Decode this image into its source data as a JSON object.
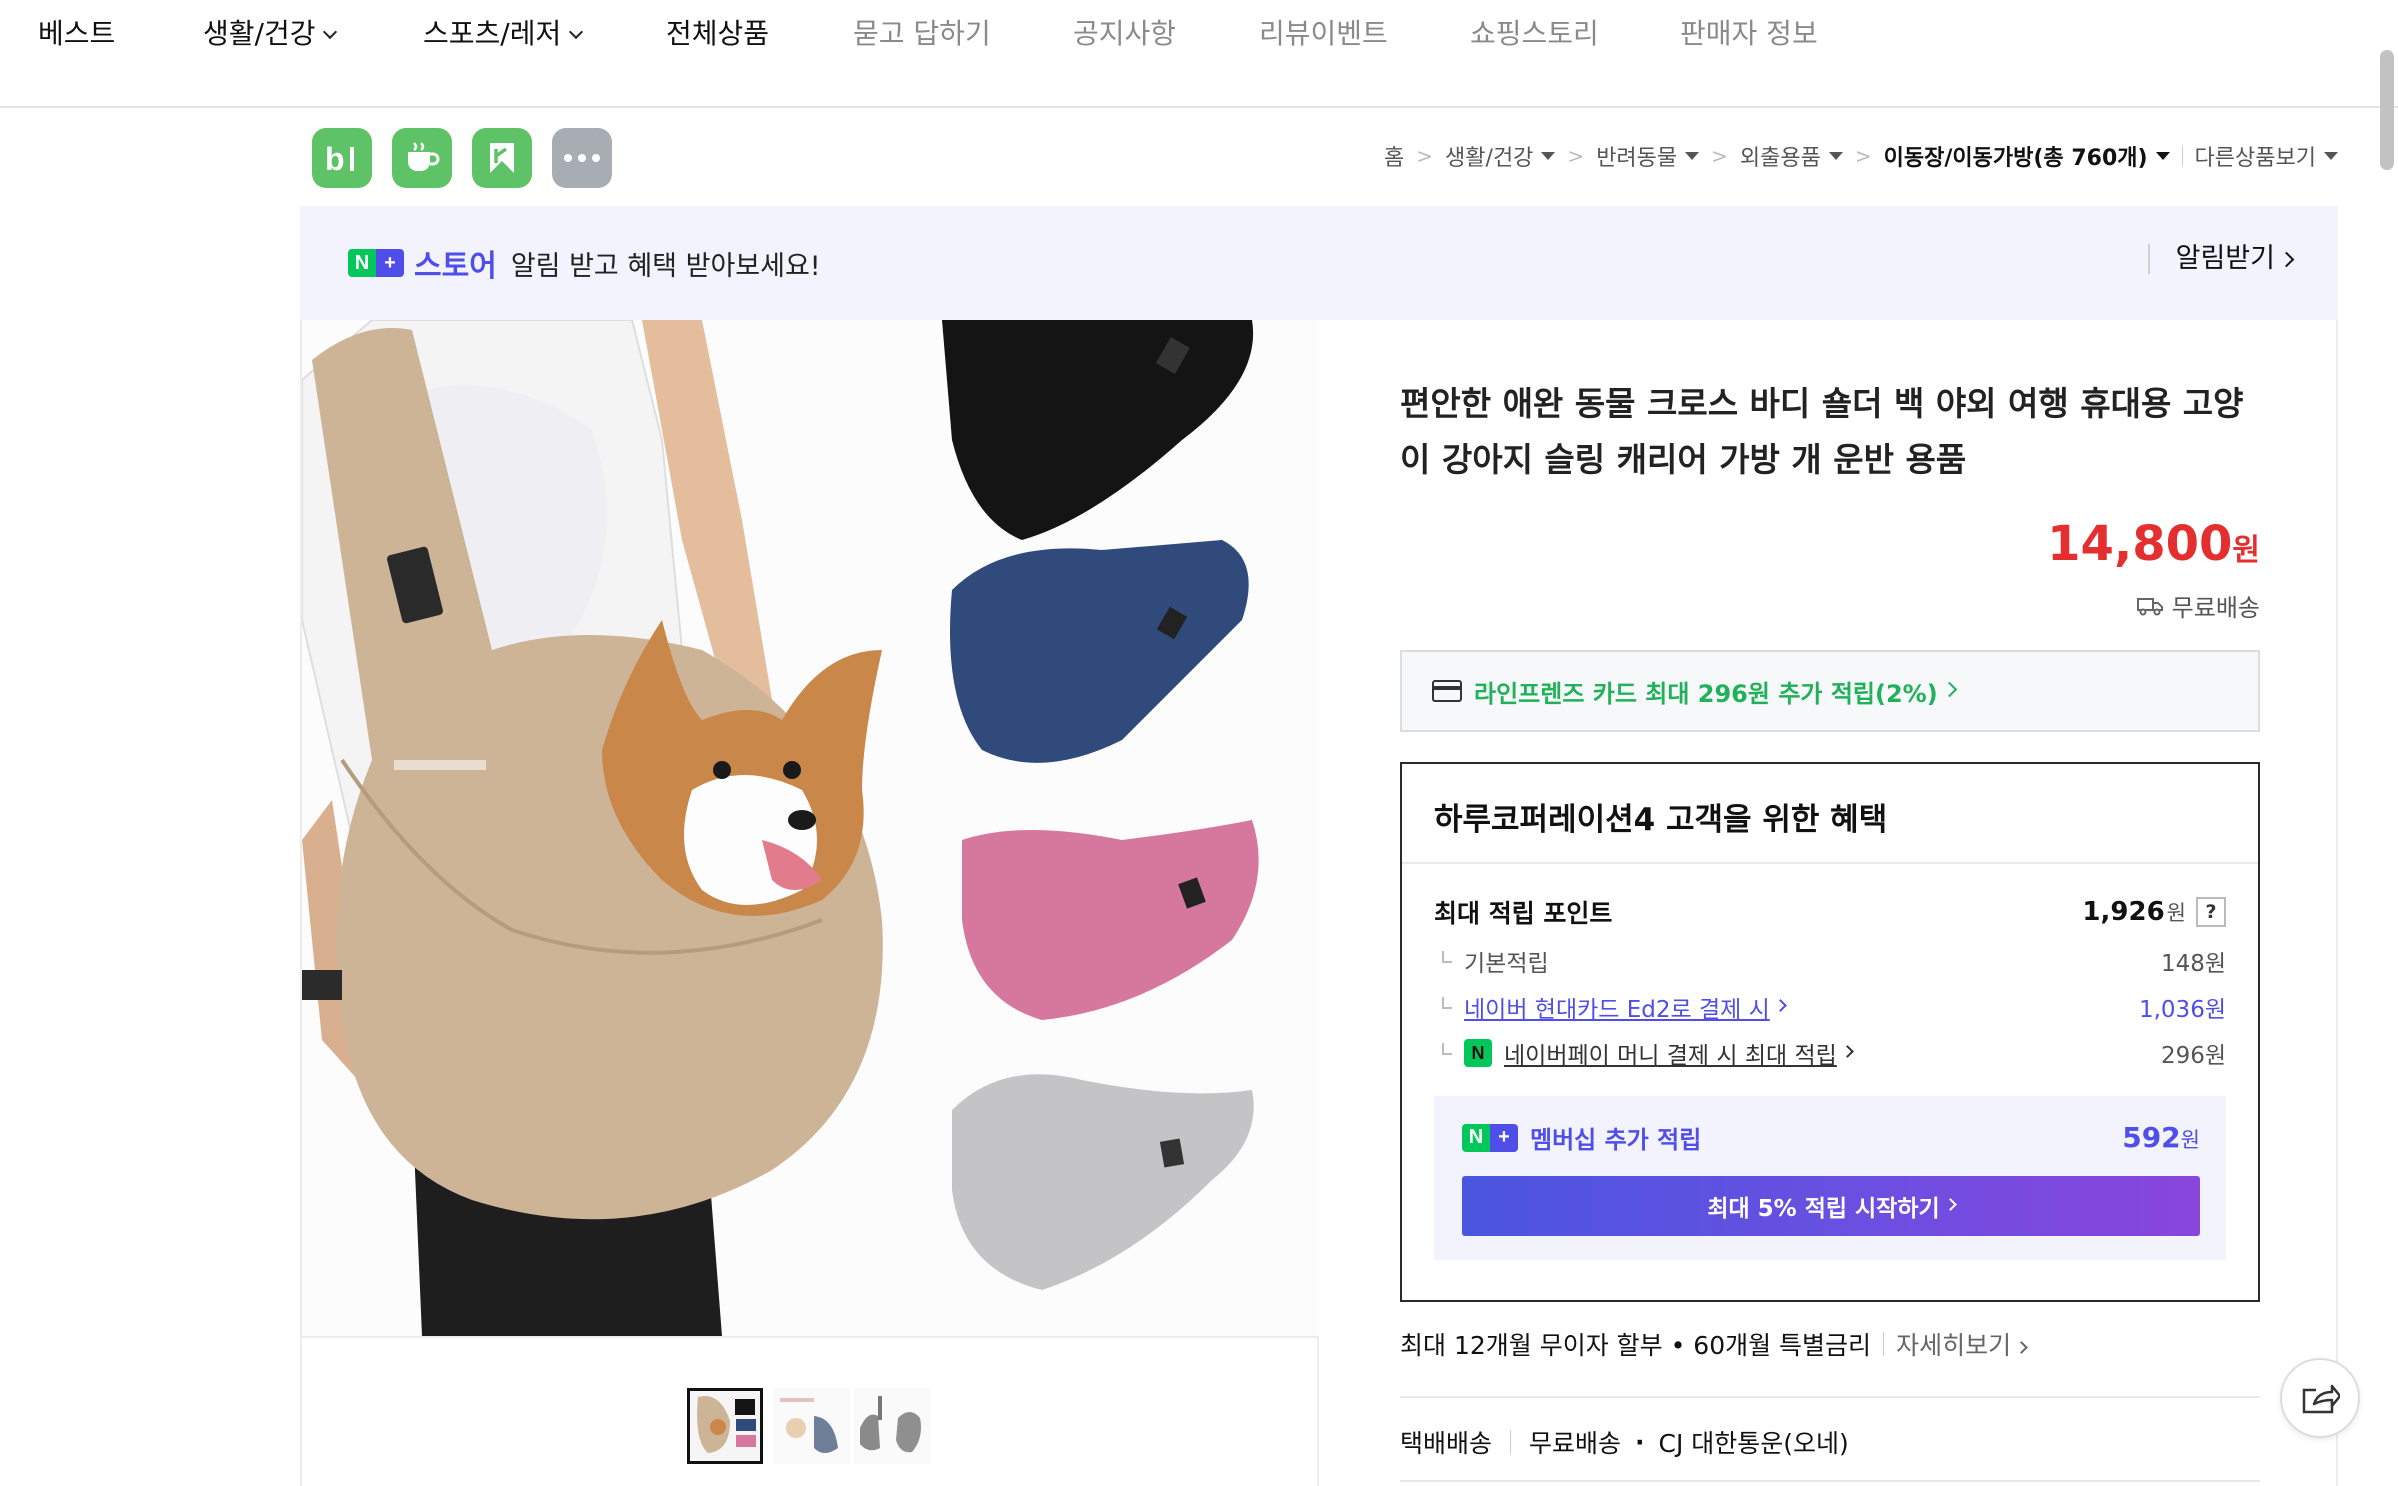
{
  "nav": {
    "items": [
      {
        "label": "베스트",
        "dropdown": false,
        "muted": false
      },
      {
        "label": "생활/건강",
        "dropdown": true,
        "muted": false
      },
      {
        "label": "스포츠/레저",
        "dropdown": true,
        "muted": false
      },
      {
        "label": "전체상품",
        "dropdown": false,
        "muted": false
      },
      {
        "label": "묻고 답하기",
        "dropdown": false,
        "muted": true
      },
      {
        "label": "공지사항",
        "dropdown": false,
        "muted": true
      },
      {
        "label": "리뷰이벤트",
        "dropdown": false,
        "muted": true
      },
      {
        "label": "쇼핑스토리",
        "dropdown": false,
        "muted": true
      },
      {
        "label": "판매자 정보",
        "dropdown": false,
        "muted": true
      }
    ]
  },
  "store_icons": [
    "blog-icon",
    "cafe-icon",
    "bookmark-icon",
    "more-icon"
  ],
  "breadcrumb": {
    "home": "홈",
    "items": [
      "생활/건강",
      "반려동물",
      "외출용품"
    ],
    "current": "이동장/이동가방(총 760개)",
    "other": "다른상품보기"
  },
  "banner": {
    "badge_n": "N",
    "badge_plus": "+",
    "store_word": "스토어",
    "message": "알림 받고 혜택 받아보세요!",
    "action": "알림받기"
  },
  "product": {
    "title": "편안한 애완 동물 크로스 바디 숄더 백 야외 여행 휴대용 고양이 강아지 슬링 캐리어 가방 개 운반 용품",
    "price": "14,800",
    "price_unit": "원",
    "shipping": "무료배송",
    "card_promo": "라인프렌즈 카드 최대 296원 추가 적립(2%)",
    "thumbnails_count": 3
  },
  "benefit": {
    "title": "하루코퍼레이션4 고객을 위한 혜택",
    "max_points_label": "최대 적립 포인트",
    "max_points_value": "1,926",
    "unit": "원",
    "help": "?",
    "rows": [
      {
        "label": "기본적립",
        "value": "148원",
        "link": false
      },
      {
        "label": "네이버 현대카드 Ed2로 결제 시",
        "value": "1,036원",
        "link": true
      },
      {
        "label": "네이버페이 머니 결제 시 최대 적립",
        "value": "296원",
        "link": true,
        "npay": true
      }
    ],
    "member_label": "멤버십 추가 적립",
    "member_value": "592",
    "cta": "최대 5% 적립 시작하기"
  },
  "installment": {
    "text": "최대 12개월 무이자 할부 • 60개월 특별금리",
    "more": "자세히보기"
  },
  "delivery": {
    "type": "택배배송",
    "fee": "무료배송",
    "courier": "CJ 대한통운(오네)",
    "dot": "·"
  },
  "npay_glyph": "N",
  "colors": {
    "accent": "#4f4ee8",
    "price": "#e32f2f",
    "green": "#03c75a",
    "promo_green": "#20b15a"
  }
}
